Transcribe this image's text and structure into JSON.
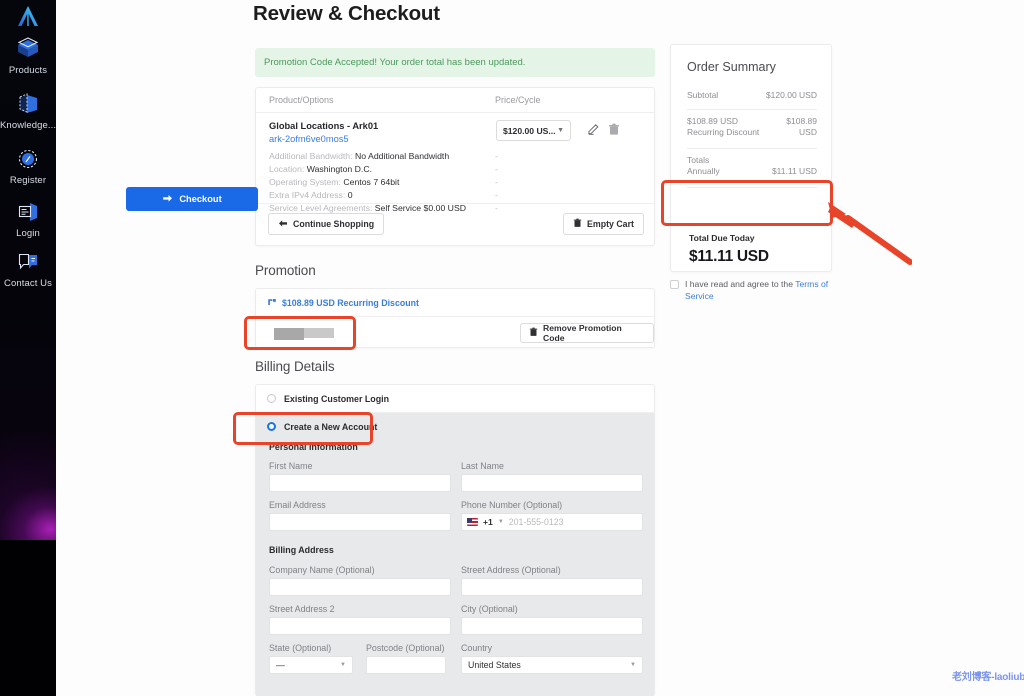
{
  "sidebar": {
    "logo_name": "brand-logo",
    "items": [
      {
        "label": "Products",
        "icon": "cube-icon"
      },
      {
        "label": "Knowledge...",
        "icon": "book-icon"
      },
      {
        "label": "Register",
        "icon": "compass-icon"
      },
      {
        "label": "Login",
        "icon": "login-card-icon"
      },
      {
        "label": "Contact Us",
        "icon": "chat-bubbles-icon"
      }
    ]
  },
  "page": {
    "title": "Review & Checkout",
    "alert": "Promotion Code Accepted! Your order total has been updated."
  },
  "cart": {
    "columns": {
      "product": "Product/Options",
      "price": "Price/Cycle"
    },
    "product_name": "Global Locations - Ark01",
    "product_id": "ark-2ofm6ve0mos5",
    "price_selected": "$120.00 US...",
    "edit_icon": "pencil-icon",
    "delete_icon": "trash-icon",
    "options": [
      {
        "label": "Additional Bandwidth:",
        "value": "No Additional Bandwidth",
        "price": "-"
      },
      {
        "label": "Location:",
        "value": "Washington D.C.",
        "price": "-"
      },
      {
        "label": "Operating System:",
        "value": "Centos 7 64bit",
        "price": "-"
      },
      {
        "label": "Extra IPv4 Address:",
        "value": "0",
        "price": "-"
      },
      {
        "label": "Service Level Agreements:",
        "value": "Self Service $0.00 USD",
        "price": "-"
      }
    ],
    "continue_shopping": "Continue Shopping",
    "empty_cart": "Empty Cart"
  },
  "promotion": {
    "heading": "Promotion",
    "discount_label": "$108.89 USD Recurring Discount",
    "code_value": "",
    "remove_button": "Remove Promotion Code"
  },
  "billing": {
    "heading": "Billing Details",
    "option_existing": "Existing Customer Login",
    "option_new": "Create a New Account",
    "selected": "Create a New Account",
    "personal_title": "Personal Information",
    "address_title": "Billing Address",
    "fields": {
      "first_name": {
        "label": "First Name",
        "value": ""
      },
      "last_name": {
        "label": "Last Name",
        "value": ""
      },
      "email": {
        "label": "Email Address",
        "value": ""
      },
      "phone": {
        "label": "Phone Number (Optional)",
        "country_code": "+1",
        "placeholder": "201-555-0123",
        "value": ""
      },
      "company": {
        "label": "Company Name (Optional)",
        "value": ""
      },
      "street1": {
        "label": "Street Address (Optional)",
        "value": ""
      },
      "street2": {
        "label": "Street Address 2",
        "value": ""
      },
      "city": {
        "label": "City (Optional)",
        "value": ""
      },
      "state": {
        "label": "State (Optional)",
        "value": "—"
      },
      "postcode": {
        "label": "Postcode (Optional)",
        "value": ""
      },
      "country": {
        "label": "Country",
        "value": "United States"
      }
    }
  },
  "summary": {
    "title": "Order Summary",
    "rows": [
      {
        "key": "Subtotal",
        "value": "$120.00 USD"
      },
      {
        "key": "$108.89 USD Recurring Discount",
        "value": "$108.89 USD"
      },
      {
        "key": "Totals\nAnnually",
        "value": "$11.11 USD"
      }
    ],
    "total_due_label": "Total Due Today",
    "total_due_value": "$11.11 USD",
    "checkout_button": "Checkout",
    "tos_prefix": "I have read and agree to the ",
    "tos_link": "Terms of Service"
  },
  "watermark": "老刘博客-laoliublog.cn",
  "colors": {
    "accent_blue": "#1a6ae8",
    "link_blue": "#3b7ddd",
    "highlight_red": "#e8442a",
    "success_green": "#4c9a5c",
    "success_bg": "#e4f4e7"
  }
}
